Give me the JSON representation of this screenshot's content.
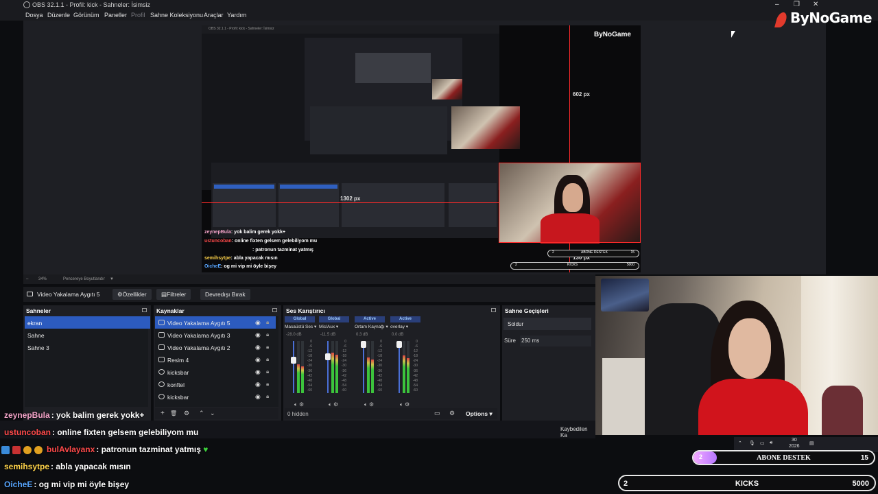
{
  "window": {
    "title": "OBS 32.1.1 - Profil: kick - Sahneler: İsimsiz",
    "minimize": "–",
    "restore": "❐",
    "close": "✕"
  },
  "menu": [
    "Dosya",
    "Düzenle",
    "Görünüm",
    "Paneller",
    "Profil",
    "Sahne Koleksiyonu",
    "Araçlar",
    "Yardım"
  ],
  "brand": {
    "logo": "ByNoGame",
    "accent": "#e23a2c"
  },
  "preview": {
    "measure_top": "602 px",
    "measure_left": "1302 px",
    "measure_bottom": "130 px",
    "nested_logo": "ByNoGame",
    "nested_chat": [
      {
        "user": "zeynepBula",
        "text": ": yok balim gerek yokk+",
        "color": "#f3a3c8"
      },
      {
        "user": "ustuncoban",
        "text": ": online fixten gelsem gelebiliyom mu",
        "color": "#ff4a4a"
      },
      {
        "user": "",
        "text": ": patronun tazminat yatmış",
        "color": "#ff4a4a"
      },
      {
        "user": "semihsytpe",
        "text": ": abla yapacak mısın",
        "color": "#ffd34a"
      },
      {
        "user": "OicheE",
        "text": ": og mi vip mi öyle bişey",
        "color": "#58a6ff"
      }
    ],
    "nested_goal_label": "ABONE DESTEK",
    "nested_goal_count": "15",
    "nested_kicks_label": "KICKS",
    "nested_kicks_count": "5000",
    "nested_goal_current": "2",
    "nested_kicks_current": "2"
  },
  "zoom": {
    "percent": "34%",
    "mode": "Pencereye Boyutlandır"
  },
  "source_toolbar": {
    "selected_source": "Video Yakalama Aygıtı 5",
    "properties": "Özellikler",
    "filters": "Filtreler",
    "deactivate": "Devredışı Bırak"
  },
  "scenes": {
    "title": "Sahneler",
    "items": [
      "ekran",
      "Sahne",
      "Sahne 3"
    ],
    "active_index": 0
  },
  "sources": {
    "title": "Kaynaklar",
    "items": [
      "Video Yakalama Aygıtı 5",
      "Video Yakalama Aygıtı 3",
      "Video Yakalama Aygıtı 2",
      "Resim 4",
      "kicksbar",
      "konftel",
      "kicksbar"
    ]
  },
  "mixer": {
    "title": "Ses Karıştırıcı",
    "channels": [
      {
        "tag": "Global",
        "name": "Masaüstü Ses",
        "db": "-28.0 dB",
        "level": 0.55,
        "fader": 0.65
      },
      {
        "tag": "Global",
        "name": "Mic/Aux",
        "db": "-11.5 dB",
        "level": 0.78,
        "fader": 0.72
      },
      {
        "tag": "Active",
        "name": "Ortam Kaynağı",
        "db": "0.3 dB",
        "level": 0.68,
        "fader": 1.0
      },
      {
        "tag": "Active",
        "name": "overlay",
        "db": "0.0 dB",
        "level": 0.72,
        "fader": 1.0
      }
    ],
    "scale": [
      "0",
      "-6",
      "-12",
      "-18",
      "-24",
      "-30",
      "-36",
      "-42",
      "-48",
      "-54",
      "-60"
    ],
    "hidden": "0 hidden",
    "options": "Options"
  },
  "transitions": {
    "title": "Sahne Geçişleri",
    "type": "Soldur",
    "duration_label": "Süre",
    "duration": "250 ms"
  },
  "taskbar": {
    "notification": "Kaybedilen Ka",
    "date": "30",
    "year": "2026"
  },
  "chat": [
    {
      "user": "zeynepBula",
      "text": ": yok balim gerek yokk+",
      "color": "#f3a3c8"
    },
    {
      "user": "ustuncoban",
      "text": ": online fixten gelsem gelebiliyom mu",
      "color": "#ff4a4a"
    },
    {
      "user": "bulAvlayanx",
      "text": ": patronun tazminat yatmış",
      "color": "#ff4a4a"
    },
    {
      "user": "semihsytpe",
      "text": ": abla yapacak mısın",
      "color": "#ffd34a"
    },
    {
      "user": "OicheE",
      "text": ": og mi vip mi öyle bişey",
      "color": "#58a6ff"
    }
  ],
  "heart": "♥",
  "goals": {
    "sub": {
      "label": "ABONE DESTEK",
      "current": "2",
      "target": "15",
      "progress": 0.13
    },
    "kicks": {
      "label": "KICKS",
      "current": "2",
      "target": "5000",
      "progress": 0.0
    }
  }
}
